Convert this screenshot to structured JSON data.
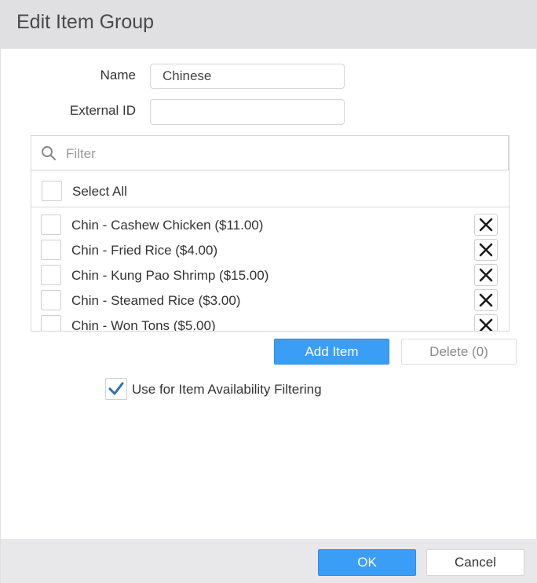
{
  "dialog": {
    "title": "Edit Item Group"
  },
  "form": {
    "name_label": "Name",
    "name_value": "Chinese",
    "external_id_label": "External ID",
    "external_id_value": ""
  },
  "list": {
    "filter_placeholder": "Filter",
    "select_all_label": "Select All",
    "items": [
      {
        "label": "Chin - Cashew Chicken ($11.00)"
      },
      {
        "label": "Chin - Fried Rice ($4.00)"
      },
      {
        "label": "Chin - Kung Pao Shrimp ($15.00)"
      },
      {
        "label": "Chin - Steamed Rice ($3.00)"
      },
      {
        "label": "Chin - Won Tons ($5.00)"
      }
    ]
  },
  "actions": {
    "add_item_label": "Add Item",
    "delete_label": "Delete (0)"
  },
  "availability": {
    "label": "Use for Item Availability Filtering",
    "checked": true
  },
  "footer": {
    "ok_label": "OK",
    "cancel_label": "Cancel"
  },
  "colors": {
    "primary": "#3a9df6",
    "checkmark": "#2d6fb3",
    "title_bar": "#e0e0e2"
  },
  "icons": {
    "filter": "search-icon",
    "remove": "close-icon",
    "check": "checkmark-icon"
  }
}
